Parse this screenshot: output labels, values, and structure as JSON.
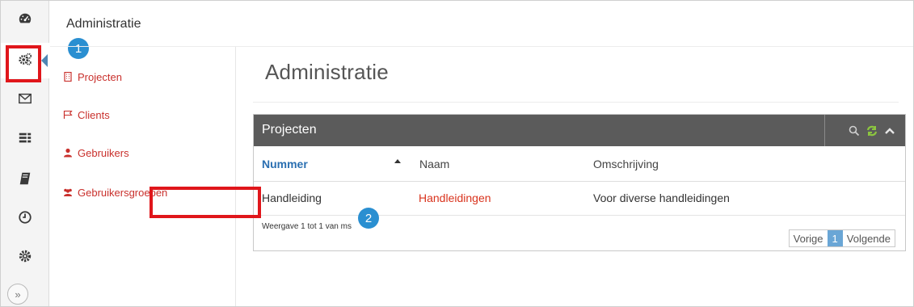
{
  "header": {
    "title": "Administratie"
  },
  "rail": {
    "items": [
      {
        "name": "dashboard",
        "icon": "dashboard-icon"
      },
      {
        "name": "admin",
        "icon": "gears-icon",
        "active": true
      },
      {
        "name": "mail",
        "icon": "envelope-icon"
      },
      {
        "name": "list",
        "icon": "list-icon"
      },
      {
        "name": "book",
        "icon": "book-icon"
      },
      {
        "name": "history",
        "icon": "clock-icon"
      },
      {
        "name": "settings",
        "icon": "gear-icon"
      }
    ],
    "collapse_icon": "double-chevron-right-icon"
  },
  "submenu": {
    "items": [
      {
        "label": "Projecten",
        "icon": "building-icon"
      },
      {
        "label": "Clients",
        "icon": "flag-icon"
      },
      {
        "label": "Gebruikers",
        "icon": "user-icon"
      },
      {
        "label": "Gebruikersgroepen",
        "icon": "users-icon"
      }
    ]
  },
  "main": {
    "page_title": "Administratie",
    "panel": {
      "title": "Projecten",
      "tools": [
        "search-icon",
        "refresh-icon",
        "chevron-up-icon"
      ],
      "columns": [
        "Nummer",
        "Naam",
        "Omschrijving"
      ],
      "rows": [
        {
          "nummer": "Handleiding",
          "naam": "Handleidingen",
          "omschrijving": "Voor diverse handleidingen"
        }
      ],
      "footer_info": "Weergave 1 tot 1 van   ms",
      "pager": {
        "prev": "Vorige",
        "page": "1",
        "next": "Volgende"
      }
    }
  },
  "annotations": {
    "badge_1": "1",
    "badge_2": "2"
  },
  "colors": {
    "accent_red": "#e0161b",
    "link_red": "#d9331d",
    "badge_blue": "#2a8fd1",
    "panel_header": "#5b5b5b"
  }
}
